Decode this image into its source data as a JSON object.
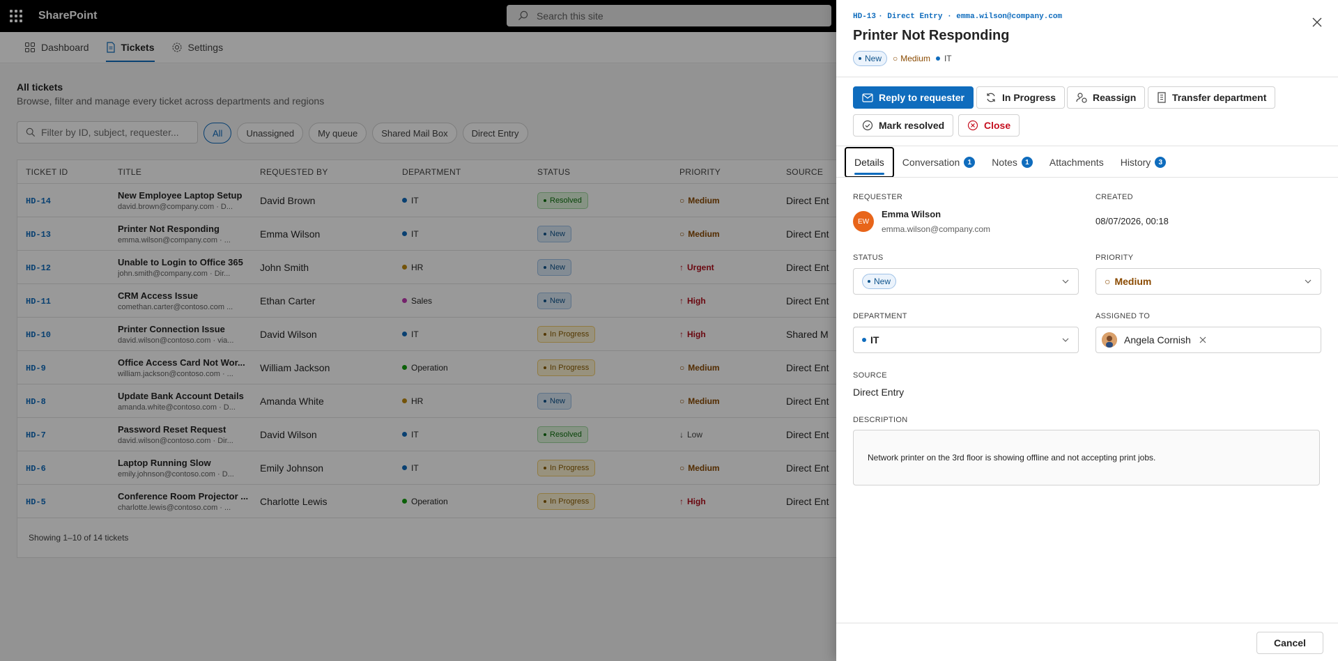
{
  "suite": {
    "app_name": "SharePoint",
    "search_placeholder": "Search this site"
  },
  "nav": {
    "items": [
      {
        "label": "Dashboard"
      },
      {
        "label": "Tickets"
      },
      {
        "label": "Settings"
      }
    ]
  },
  "main": {
    "title": "All tickets",
    "subtitle": "Browse, filter and manage every ticket across departments and regions",
    "filter_placeholder": "Filter by ID, subject, requester...",
    "pills": [
      "All",
      "Unassigned",
      "My queue",
      "Shared Mail Box",
      "Direct Entry"
    ],
    "columns": [
      "TICKET ID",
      "TITLE",
      "REQUESTED BY",
      "DEPARTMENT",
      "STATUS",
      "PRIORITY",
      "SOURCE"
    ],
    "rows": [
      {
        "id": "HD-14",
        "title": "New Employee Laptop Setup",
        "meta": "david.brown@company.com · D...",
        "requester": "David Brown",
        "dept": "IT",
        "dept_color": "#0f6cbd",
        "status": "Resolved",
        "status_kind": "resolved",
        "priority": "Medium",
        "prio_kind": "medium",
        "prio_icon": "○",
        "source": "Direct Ent"
      },
      {
        "id": "HD-13",
        "title": "Printer Not Responding",
        "meta": "emma.wilson@company.com · ...",
        "requester": "Emma Wilson",
        "dept": "IT",
        "dept_color": "#0f6cbd",
        "status": "New",
        "status_kind": "new",
        "priority": "Medium",
        "prio_kind": "medium",
        "prio_icon": "○",
        "source": "Direct Ent"
      },
      {
        "id": "HD-12",
        "title": "Unable to Login to Office 365",
        "meta": "john.smith@company.com · Dir...",
        "requester": "John Smith",
        "dept": "HR",
        "dept_color": "#c08a10",
        "status": "New",
        "status_kind": "new",
        "priority": "Urgent",
        "prio_kind": "urgent",
        "prio_icon": "↑",
        "source": "Direct Ent"
      },
      {
        "id": "HD-11",
        "title": "CRM Access Issue",
        "meta": "comethan.carter@contoso.com ...",
        "requester": "Ethan Carter",
        "dept": "Sales",
        "dept_color": "#c239b3",
        "status": "New",
        "status_kind": "new",
        "priority": "High",
        "prio_kind": "high",
        "prio_icon": "↑",
        "source": "Direct Ent"
      },
      {
        "id": "HD-10",
        "title": "Printer Connection Issue",
        "meta": "david.wilson@contoso.com · via...",
        "requester": "David Wilson",
        "dept": "IT",
        "dept_color": "#0f6cbd",
        "status": "In Progress",
        "status_kind": "progress",
        "priority": "High",
        "prio_kind": "high",
        "prio_icon": "↑",
        "source": "Shared M"
      },
      {
        "id": "HD-9",
        "title": "Office Access Card Not Wor...",
        "meta": "william.jackson@contoso.com · ...",
        "requester": "William Jackson",
        "dept": "Operation",
        "dept_color": "#13a10e",
        "status": "In Progress",
        "status_kind": "progress",
        "priority": "Medium",
        "prio_kind": "medium",
        "prio_icon": "○",
        "source": "Direct Ent"
      },
      {
        "id": "HD-8",
        "title": "Update Bank Account Details",
        "meta": "amanda.white@contoso.com · D...",
        "requester": "Amanda White",
        "dept": "HR",
        "dept_color": "#c08a10",
        "status": "New",
        "status_kind": "new",
        "priority": "Medium",
        "prio_kind": "medium",
        "prio_icon": "○",
        "source": "Direct Ent"
      },
      {
        "id": "HD-7",
        "title": "Password Reset Request",
        "meta": "david.wilson@contoso.com · Dir...",
        "requester": "David Wilson",
        "dept": "IT",
        "dept_color": "#0f6cbd",
        "status": "Resolved",
        "status_kind": "resolved",
        "priority": "Low",
        "prio_kind": "low",
        "prio_icon": "↓",
        "source": "Direct Ent"
      },
      {
        "id": "HD-6",
        "title": "Laptop Running Slow",
        "meta": "emily.johnson@contoso.com · D...",
        "requester": "Emily Johnson",
        "dept": "IT",
        "dept_color": "#0f6cbd",
        "status": "In Progress",
        "status_kind": "progress",
        "priority": "Medium",
        "prio_kind": "medium",
        "prio_icon": "○",
        "source": "Direct Ent"
      },
      {
        "id": "HD-5",
        "title": "Conference Room Projector ...",
        "meta": "charlotte.lewis@contoso.com · ...",
        "requester": "Charlotte Lewis",
        "dept": "Operation",
        "dept_color": "#13a10e",
        "status": "In Progress",
        "status_kind": "progress",
        "priority": "High",
        "prio_kind": "high",
        "prio_icon": "↑",
        "source": "Direct Ent"
      }
    ],
    "footer": "Showing 1–10 of 14 tickets"
  },
  "panel": {
    "ticket_id": "HD-13",
    "meta_suffix": "· Direct Entry · emma.wilson@company.com",
    "title": "Printer Not Responding",
    "tags": {
      "status": "New",
      "priority": "Medium",
      "department": "IT"
    },
    "actions": {
      "reply": "Reply to requester",
      "in_progress": "In Progress",
      "reassign": "Reassign",
      "transfer": "Transfer department",
      "resolve": "Mark resolved",
      "close": "Close"
    },
    "tabs": [
      {
        "label": "Details",
        "count": null
      },
      {
        "label": "Conversation",
        "count": "1"
      },
      {
        "label": "Notes",
        "count": "1"
      },
      {
        "label": "Attachments",
        "count": null
      },
      {
        "label": "History",
        "count": "3"
      }
    ],
    "requester": {
      "label": "REQUESTER",
      "initials": "EW",
      "name": "Emma Wilson",
      "email": "emma.wilson@company.com"
    },
    "created": {
      "label": "CREATED",
      "value": "08/07/2026, 00:18"
    },
    "status": {
      "label": "STATUS",
      "value": "New"
    },
    "priority": {
      "label": "PRIORITY",
      "value": "Medium"
    },
    "department": {
      "label": "DEPARTMENT",
      "value": "IT"
    },
    "assigned": {
      "label": "ASSIGNED TO",
      "value": "Angela Cornish"
    },
    "source": {
      "label": "SOURCE",
      "value": "Direct Entry"
    },
    "description": {
      "label": "DESCRIPTION",
      "value": "Network printer on the 3rd floor is showing offline and not accepting print jobs."
    },
    "cancel": "Cancel"
  },
  "colors": {
    "accent": "#0f6cbd",
    "danger": "#c50f1f",
    "avatar_requester": "#e8651a"
  }
}
